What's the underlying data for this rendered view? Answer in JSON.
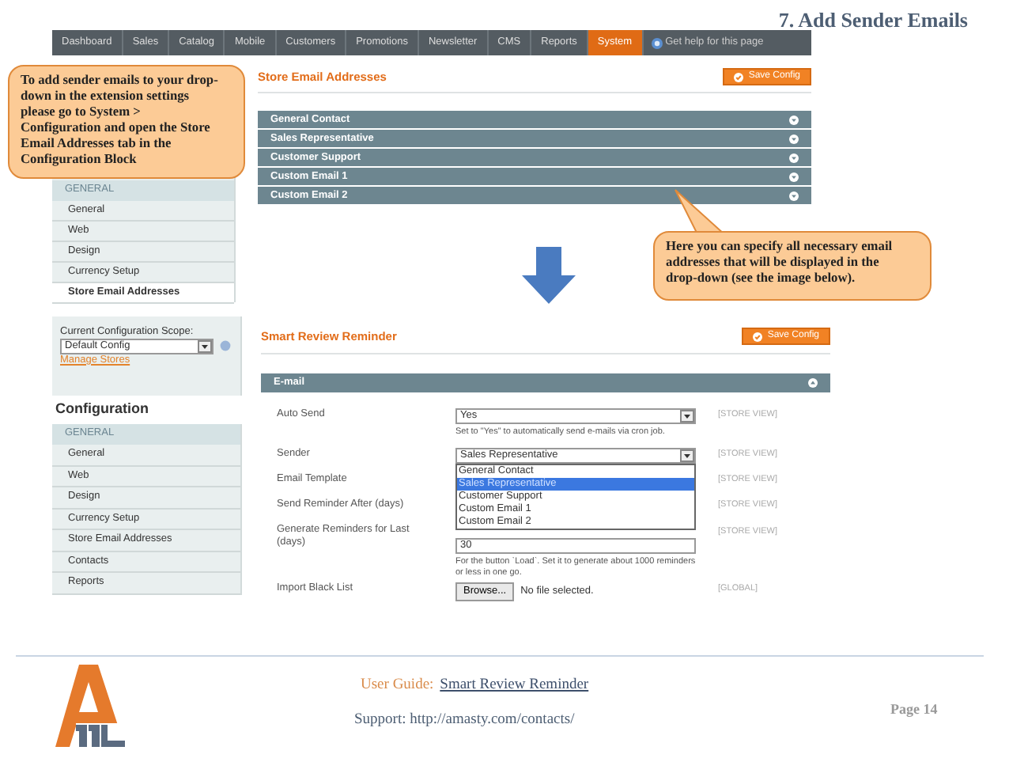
{
  "title": "7. Add Sender Emails",
  "top_screen": {
    "nav": [
      {
        "label": "Dashboard",
        "selected": false
      },
      {
        "label": "Sales",
        "selected": false
      },
      {
        "label": "Catalog",
        "selected": false
      },
      {
        "label": "Mobile",
        "selected": false
      },
      {
        "label": "Customers",
        "selected": false
      },
      {
        "label": "Promotions",
        "selected": false
      },
      {
        "label": "Newsletter",
        "selected": false
      },
      {
        "label": "CMS",
        "selected": false
      },
      {
        "label": "Reports",
        "selected": false
      },
      {
        "label": "System",
        "selected": true
      }
    ],
    "help_link": "Get help for this page",
    "sidebar": {
      "group": "GENERAL",
      "items": [
        {
          "label": "General",
          "selected": false
        },
        {
          "label": "Web",
          "selected": false
        },
        {
          "label": "Design",
          "selected": false
        },
        {
          "label": "Currency Setup",
          "selected": false
        },
        {
          "label": "Store Email Addresses",
          "selected": true
        }
      ]
    },
    "heading": "Store Email Addresses",
    "save_button": "Save Config",
    "sections": [
      "General Contact",
      "Sales Representative",
      "Customer Support",
      "Custom Email 1",
      "Custom Email 2"
    ]
  },
  "callouts": [
    {
      "text": "To add sender emails to your drop- down in the extension settings please go to System > Configuration and open the Store Email Addresses tab in the Configuration Block"
    },
    {
      "text": "Here you can specify all necessary email addresses that will be displayed in the drop-down (see the image below).",
      "pointer": true
    }
  ],
  "bottom_screen": {
    "scope_label": "Current Configuration Scope:",
    "scope_value": "Default Config",
    "manage_link": "Manage Stores",
    "config_heading": "Configuration",
    "sidebar": {
      "group": "GENERAL",
      "items": [
        {
          "label": "General",
          "selected": false
        },
        {
          "label": "Web",
          "selected": false
        },
        {
          "label": "Design",
          "selected": false
        },
        {
          "label": "Currency Setup",
          "selected": false
        },
        {
          "label": "Store Email Addresses",
          "selected": false
        },
        {
          "label": "Contacts",
          "selected": false
        },
        {
          "label": "Reports",
          "selected": false
        }
      ]
    },
    "heading": "Smart Review Reminder",
    "save_button": "Save Config",
    "section": "E-mail",
    "fields": [
      {
        "kind": "select",
        "label": "Auto Send",
        "value": "Yes",
        "note": "Set to \"Yes\" to automatically send e-mails via cron job.",
        "scope": "[STORE VIEW]"
      },
      {
        "kind": "select",
        "label": "Sender",
        "value": "Sales Representative",
        "expanded": true,
        "options": [
          {
            "label": "General Contact",
            "selected": false
          },
          {
            "label": "Sales Representative",
            "selected": true
          },
          {
            "label": "Customer Support",
            "selected": false
          },
          {
            "label": "Custom Email 1",
            "selected": false
          },
          {
            "label": "Custom Email 2",
            "selected": false
          }
        ],
        "scope": "[STORE VIEW]"
      },
      {
        "kind": "hidden",
        "label": "Email Template",
        "scope": "[STORE VIEW]"
      },
      {
        "kind": "hidden",
        "label": "Send Reminder After (days)",
        "scope": "[STORE VIEW]"
      },
      {
        "kind": "text",
        "label": "Generate Reminders for Last (days)",
        "value": "30",
        "note": "For the button `Load`. Set it to generate about 1000 reminders or less in one go.",
        "scope": "[STORE VIEW]"
      },
      {
        "kind": "file",
        "label": "Import Black List",
        "button": "Browse...",
        "value": "No file selected.",
        "scope": "[GLOBAL]"
      }
    ]
  },
  "footer": {
    "guide_label": "User Guide:",
    "guide_link": "Smart Review Reminder",
    "support": "Support: http://amasty.com/contacts/",
    "page": "Page 14"
  }
}
